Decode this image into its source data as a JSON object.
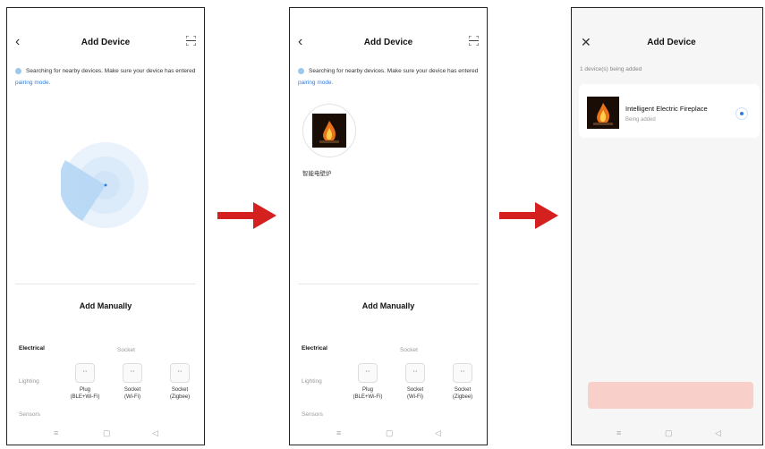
{
  "screens": {
    "search": {
      "title": "Add Device",
      "hint_text": "Searching for nearby devices. Make sure your device has entered",
      "hint_link": "pairing mode."
    },
    "manual": {
      "heading": "Add Manually",
      "categories": [
        "Electrical",
        "Lighting",
        "Sensors"
      ],
      "subcategory": "Socket",
      "devices": [
        {
          "line1": "Plug",
          "line2": "(BLE+Wi-Fi)"
        },
        {
          "line1": "Socket",
          "line2": "(Wi-Fi)"
        },
        {
          "line1": "Socket",
          "line2": "(Zigbee)"
        }
      ]
    },
    "found": {
      "device_name": "智能电壁炉"
    },
    "adding": {
      "title": "Add Device",
      "count_text": "1 device(s) being added",
      "device_name": "Intelligent Electric Fireplace",
      "device_status": "Being added"
    }
  },
  "colors": {
    "accent": "#2f7fe0",
    "arrow": "#d52020",
    "radar": "#9bc8ef"
  }
}
